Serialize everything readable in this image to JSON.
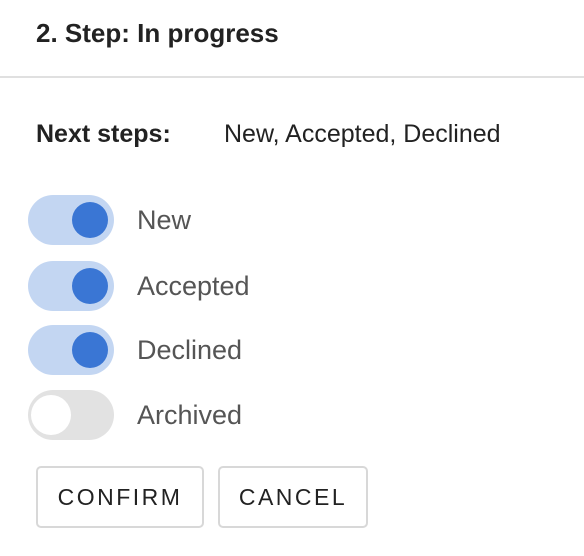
{
  "header": {
    "title": "2. Step: In progress"
  },
  "next_steps": {
    "label": "Next steps:",
    "value": "New, Accepted, Declined"
  },
  "toggles": [
    {
      "label": "New",
      "checked": true
    },
    {
      "label": "Accepted",
      "checked": true
    },
    {
      "label": "Declined",
      "checked": true
    },
    {
      "label": "Archived",
      "checked": false
    }
  ],
  "actions": {
    "confirm_label": "CONFIRM",
    "cancel_label": "CANCEL"
  },
  "colors": {
    "toggle_on_track": "#c3d6f2",
    "toggle_on_knob": "#3a76d4",
    "toggle_off_track": "#e2e2e2",
    "toggle_off_knob": "#ffffff"
  }
}
